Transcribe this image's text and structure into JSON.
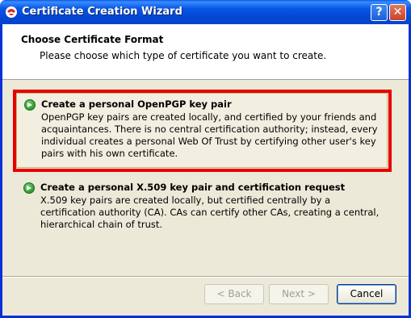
{
  "window": {
    "title": "Certificate Creation Wizard",
    "help_label": "?",
    "close_label": "✕"
  },
  "header": {
    "title": "Choose Certificate Format",
    "subtitle": "Please choose which type of certificate you want to create."
  },
  "options": [
    {
      "title": "Create a personal OpenPGP key pair",
      "description": "OpenPGP key pairs are created locally, and certified by your friends and acquaintances. There is no central certification authority; instead, every individual creates a personal Web Of Trust by certifying other user's key pairs with his own certificate.",
      "selected": true
    },
    {
      "title": "Create a personal X.509 key pair and certification request",
      "description": "X.509 key pairs are created locally, but certified centrally by a certification authority (CA). CAs can certify other CAs, creating a central, hierarchical chain of trust.",
      "selected": false
    }
  ],
  "buttons": {
    "back": "< Back",
    "next": "Next >",
    "cancel": "Cancel"
  },
  "colors": {
    "highlight_border": "#e60000",
    "titlebar": "#0447d6"
  }
}
